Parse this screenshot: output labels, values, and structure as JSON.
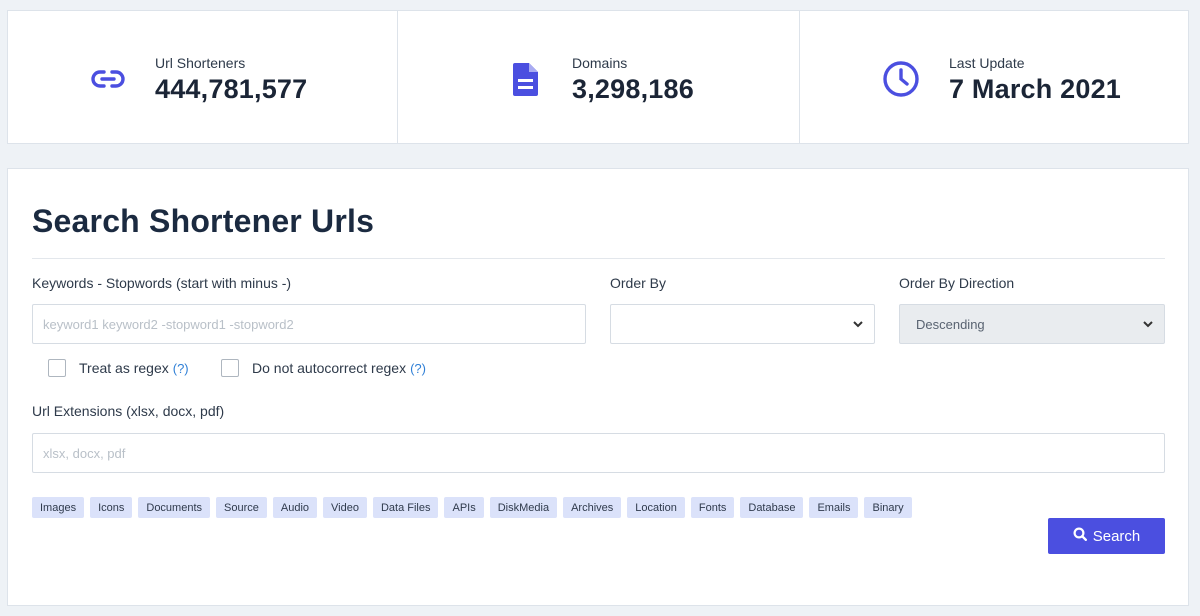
{
  "stats": [
    {
      "label": "Url Shorteners",
      "value": "444,781,577",
      "icon": "link-icon"
    },
    {
      "label": "Domains",
      "value": "3,298,186",
      "icon": "document-icon"
    },
    {
      "label": "Last Update",
      "value": "7 March 2021",
      "icon": "clock-icon"
    }
  ],
  "search": {
    "title": "Search Shortener Urls",
    "keywords_label": "Keywords - Stopwords (start with minus -)",
    "keywords_placeholder": "keyword1 keyword2 -stopword1 -stopword2",
    "order_by_label": "Order By",
    "order_by_value": "",
    "order_dir_label": "Order By Direction",
    "order_dir_value": "Descending",
    "regex_label": "Treat as regex",
    "regex_help": "(?)",
    "autocorrect_label": "Do not autocorrect regex",
    "autocorrect_help": "(?)",
    "extensions_label": "Url Extensions (xlsx, docx, pdf)",
    "extensions_placeholder": "xlsx, docx, pdf",
    "tags": [
      "Images",
      "Icons",
      "Documents",
      "Source",
      "Audio",
      "Video",
      "Data Files",
      "APIs",
      "DiskMedia",
      "Archives",
      "Location",
      "Fonts",
      "Database",
      "Emails",
      "Binary"
    ],
    "button_label": "Search"
  },
  "colors": {
    "accent": "#4b4fe0",
    "tag_bg": "#dbe2fa",
    "help_link": "#2f7fd6"
  }
}
